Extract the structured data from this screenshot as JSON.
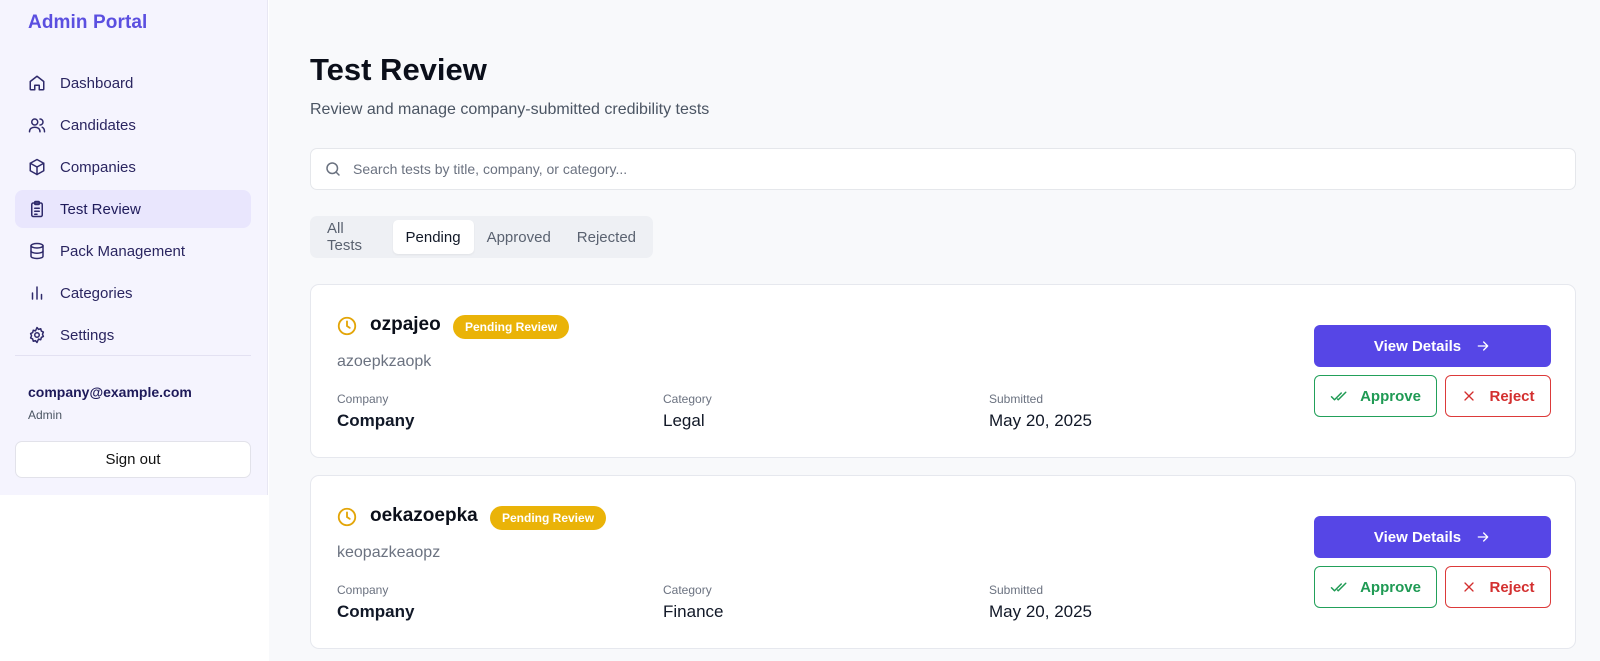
{
  "sidebar": {
    "brand": "Admin Portal",
    "items": [
      {
        "label": "Dashboard",
        "icon": "home-icon"
      },
      {
        "label": "Candidates",
        "icon": "users-icon"
      },
      {
        "label": "Companies",
        "icon": "package-icon"
      },
      {
        "label": "Test Review",
        "icon": "clipboard-list-icon",
        "active": true
      },
      {
        "label": "Pack Management",
        "icon": "database-icon"
      },
      {
        "label": "Categories",
        "icon": "bar-chart-icon"
      },
      {
        "label": "Settings",
        "icon": "gear-icon"
      }
    ],
    "user": {
      "email": "company@example.com",
      "role": "Admin"
    },
    "signout_label": "Sign out"
  },
  "main": {
    "title": "Test Review",
    "subtitle": "Review and manage company-submitted credibility tests",
    "search": {
      "placeholder": "Search tests by title, company, or category...",
      "value": ""
    },
    "tabs": [
      {
        "label": "All Tests"
      },
      {
        "label": "Pending",
        "active": true
      },
      {
        "label": "Approved"
      },
      {
        "label": "Rejected"
      }
    ],
    "meta_labels": {
      "company": "Company",
      "category": "Category",
      "submitted": "Submitted"
    },
    "actions": {
      "view_details": "View Details",
      "approve": "Approve",
      "reject": "Reject"
    },
    "tests": [
      {
        "title": "ozpajeo",
        "status": "Pending Review",
        "description": "azoepkzaopk",
        "company": "Company",
        "category": "Legal",
        "submitted": "May 20, 2025"
      },
      {
        "title": "oekazoepka",
        "status": "Pending Review",
        "description": "keopazkeaopz",
        "company": "Company",
        "category": "Finance",
        "submitted": "May 20, 2025"
      }
    ]
  },
  "colors": {
    "accent": "#5646e6",
    "brand": "#5b4fe0",
    "pending_badge": "#eab308",
    "approve": "#1f9a54",
    "reject": "#d32f2f"
  }
}
